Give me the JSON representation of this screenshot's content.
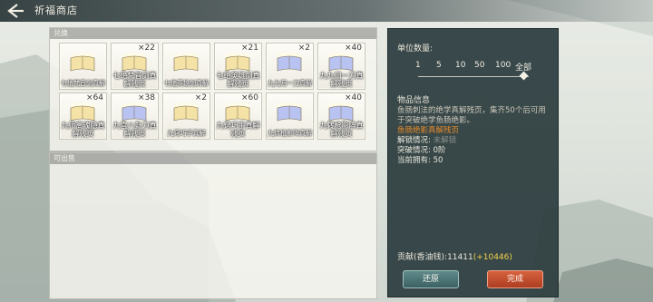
{
  "header": {
    "title": "祈福商店"
  },
  "exchange_panel": {
    "label": "兑换",
    "items": [
      {
        "name": "七绝梵音剑真解",
        "count": "",
        "color": "#f5e2a7"
      },
      {
        "name": "七绝梵音剑真解残页",
        "count": "×22",
        "color": "#f5e2a7"
      },
      {
        "name": "七绝英雄剑真解",
        "count": "",
        "color": "#f5e2a7"
      },
      {
        "name": "七绝英雄剑真解残页",
        "count": "×21",
        "color": "#f5e2a7"
      },
      {
        "name": "九九归一刀真解",
        "count": "×2",
        "color": "#b9c3f2"
      },
      {
        "name": "九九归一刀真解残页",
        "count": "×40",
        "color": "#b9c3f2"
      },
      {
        "name": "九师离魂隐真解残页",
        "count": "×64",
        "color": "#f5e2a7"
      },
      {
        "name": "九宫八卦刀真解残页",
        "count": "×38",
        "color": "#b9c3f2"
      },
      {
        "name": "九窍巧手真解",
        "count": "×2",
        "color": "#f5e2a7"
      },
      {
        "name": "九窍巧手真解残页",
        "count": "×60",
        "color": "#f5e2a7"
      },
      {
        "name": "九转枪影阵真解",
        "count": "",
        "color": "#b9c3f2"
      },
      {
        "name": "九转枪影阵真解残页",
        "count": "×40",
        "color": "#b9c3f2"
      }
    ]
  },
  "sell_panel": {
    "label": "可出售"
  },
  "info_panel": {
    "unit_qty_label": "单位数量:",
    "qty_options": [
      "1",
      "5",
      "10",
      "50",
      "100",
      "全部"
    ],
    "item_info_label": "物品信息",
    "description": "鱼肠刺法的绝学真解残页，集齐50个后可用于突破绝学鱼肠绝影。",
    "item_name": "鱼肠绝影真解残页",
    "unlock_label": "解锁情况:",
    "unlock_value": "未解锁",
    "breakthrough_label": "突破情况:",
    "breakthrough_value": "0阶",
    "owned_label": "当前拥有:",
    "owned_value": "50",
    "contribution_label": "贡献(香油钱):",
    "contribution_value": "11411",
    "contribution_delta": "(+10446)",
    "reset_button": "还原",
    "done_button": "完成"
  }
}
